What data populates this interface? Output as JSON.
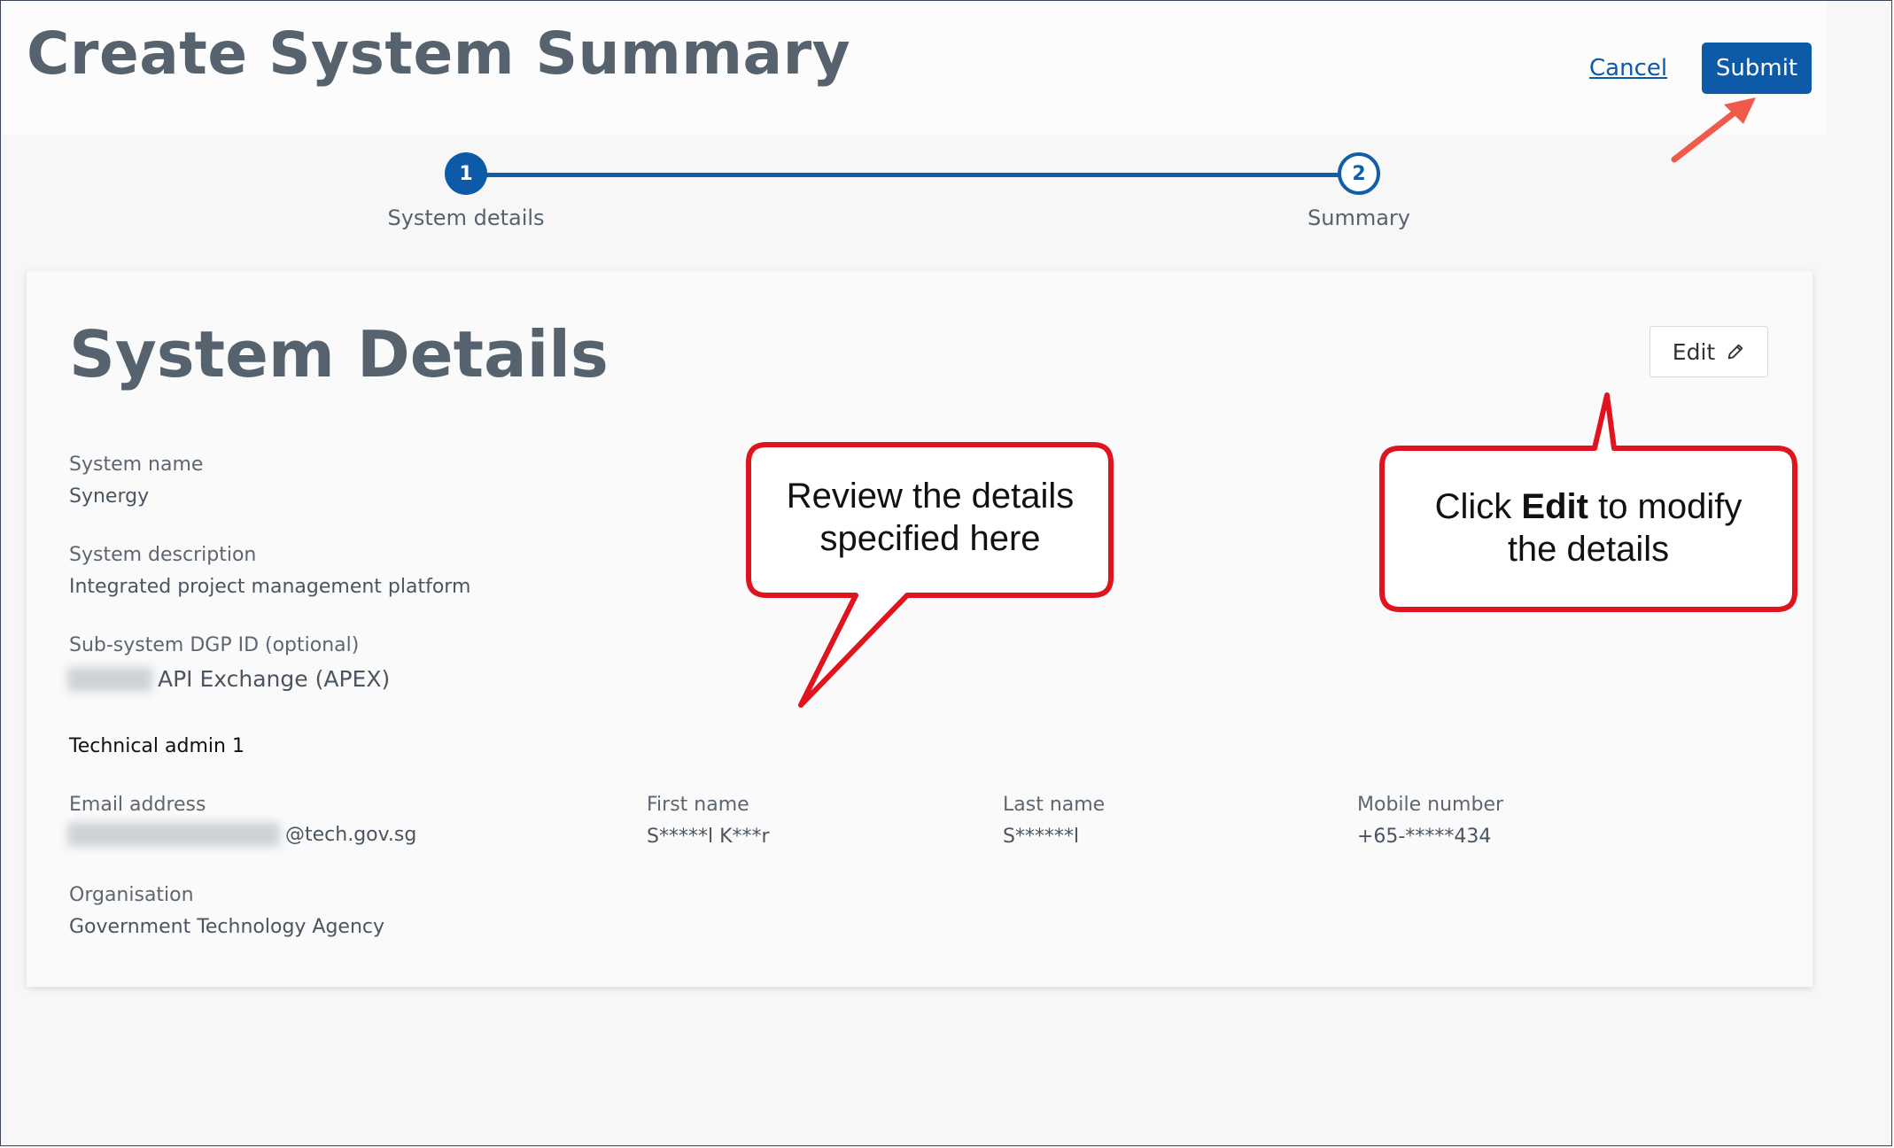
{
  "header": {
    "title": "Create System Summary",
    "cancel_label": "Cancel",
    "submit_label": "Submit"
  },
  "stepper": {
    "steps": [
      {
        "number": "1",
        "label": "System details"
      },
      {
        "number": "2",
        "label": "Summary"
      }
    ]
  },
  "card": {
    "title": "System Details",
    "edit_label": "Edit",
    "fields": {
      "system_name": {
        "label": "System name",
        "value": "Synergy"
      },
      "system_description": {
        "label": "System description",
        "value": "Integrated project management platform"
      },
      "sub_system": {
        "label": "Sub-system DGP ID (optional)",
        "value": "API Exchange (APEX)"
      },
      "technical_admin_heading": "Technical admin 1",
      "email": {
        "label": "Email address",
        "value": "@tech.gov.sg"
      },
      "first_name": {
        "label": "First name",
        "value": "S*****l K***r"
      },
      "last_name": {
        "label": "Last name",
        "value": "S******l"
      },
      "mobile": {
        "label": "Mobile number",
        "value": "+65-*****434"
      },
      "organisation": {
        "label": "Organisation",
        "value": "Government Technology Agency"
      }
    }
  },
  "callouts": {
    "review_line1": "Review the details",
    "review_line2": "specified here",
    "edit_pre": "Click ",
    "edit_bold": "Edit",
    "edit_post": " to modify",
    "edit_line2": "the details"
  },
  "colors": {
    "primary": "#0c5aa8",
    "callout_border": "#e0141e",
    "arrow": "#f05a4a"
  }
}
